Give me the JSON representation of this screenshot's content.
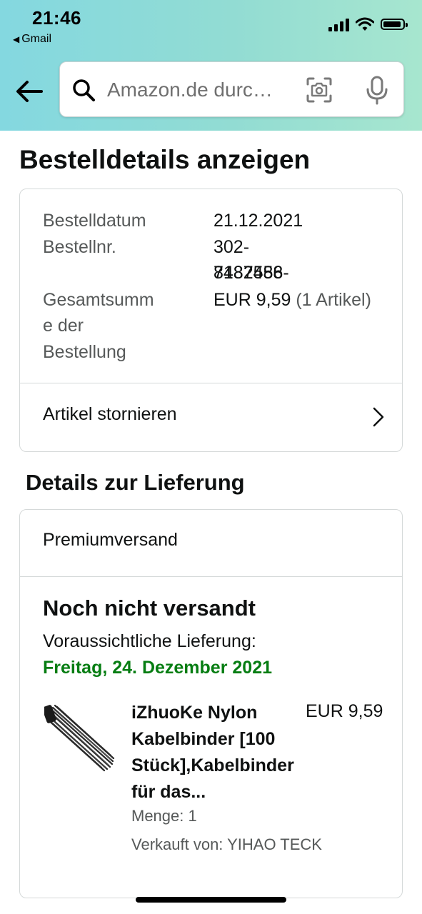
{
  "status_bar": {
    "time": "21:46",
    "back_app": "Gmail"
  },
  "search": {
    "placeholder": "Amazon.de durc…"
  },
  "page_title": "Bestelldetails anzeigen",
  "order": {
    "date_label": "Bestelldatum",
    "date_value": "21.12.2021",
    "number_label": "Bestellnr.",
    "number_value_line1": "302-8482486-",
    "number_value_line2": "7187558",
    "total_label_line1": "Gesamtsumm",
    "total_label_line2": "e der",
    "total_label_line3": "Bestellung",
    "total_amount": "EUR 9,59",
    "total_items": "(1 Artikel)",
    "cancel_label": "Artikel stornieren"
  },
  "delivery": {
    "section_title": "Details zur Lieferung",
    "shipping_method": "Premiumversand",
    "status": "Noch nicht versandt",
    "eta_label": "Voraussichtliche Lieferung:",
    "eta_date": "Freitag, 24. Dezember 2021",
    "eta_color": "#067d12",
    "item": {
      "title_line1": "iZhuoKe Nylon",
      "title_line2": "Kabelbinder [100",
      "title_line3": "Stück],Kabelbinder",
      "title_line4": "für das...",
      "price": "EUR 9,59",
      "quantity": "Menge: 1",
      "seller": "Verkauft von: YIHAO TECK"
    }
  },
  "icons": [
    "back-arrow-icon",
    "search-icon",
    "camera-icon",
    "microphone-icon",
    "chevron-right-icon",
    "signal-icon",
    "wifi-icon",
    "battery-icon"
  ]
}
